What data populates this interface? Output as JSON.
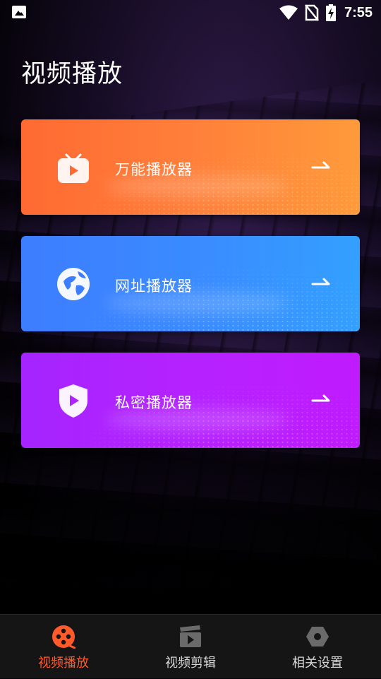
{
  "status_bar": {
    "time": "7:55",
    "icons": [
      "image-icon",
      "wifi-icon",
      "no-sim-icon",
      "battery-charging-icon"
    ]
  },
  "page_title": "视频播放",
  "cards": [
    {
      "label": "万能播放器",
      "icon": "tv-play-icon",
      "gradient": [
        "#ff6a32",
        "#ff9a3a"
      ]
    },
    {
      "label": "网址播放器",
      "icon": "globe-icon",
      "gradient": [
        "#3d7dff",
        "#33a0ff"
      ]
    },
    {
      "label": "私密播放器",
      "icon": "shield-play-icon",
      "gradient": [
        "#a524ff",
        "#c01aff"
      ]
    }
  ],
  "bottom_nav": [
    {
      "label": "视频播放",
      "icon": "film-reel-icon",
      "active": true
    },
    {
      "label": "视频剪辑",
      "icon": "clapperboard-icon",
      "active": false
    },
    {
      "label": "相关设置",
      "icon": "hexagon-settings-icon",
      "active": false
    }
  ],
  "colors": {
    "accent": "#ff5a2a",
    "nav_background": "#151515",
    "inactive_text": "#d8d8d8"
  }
}
